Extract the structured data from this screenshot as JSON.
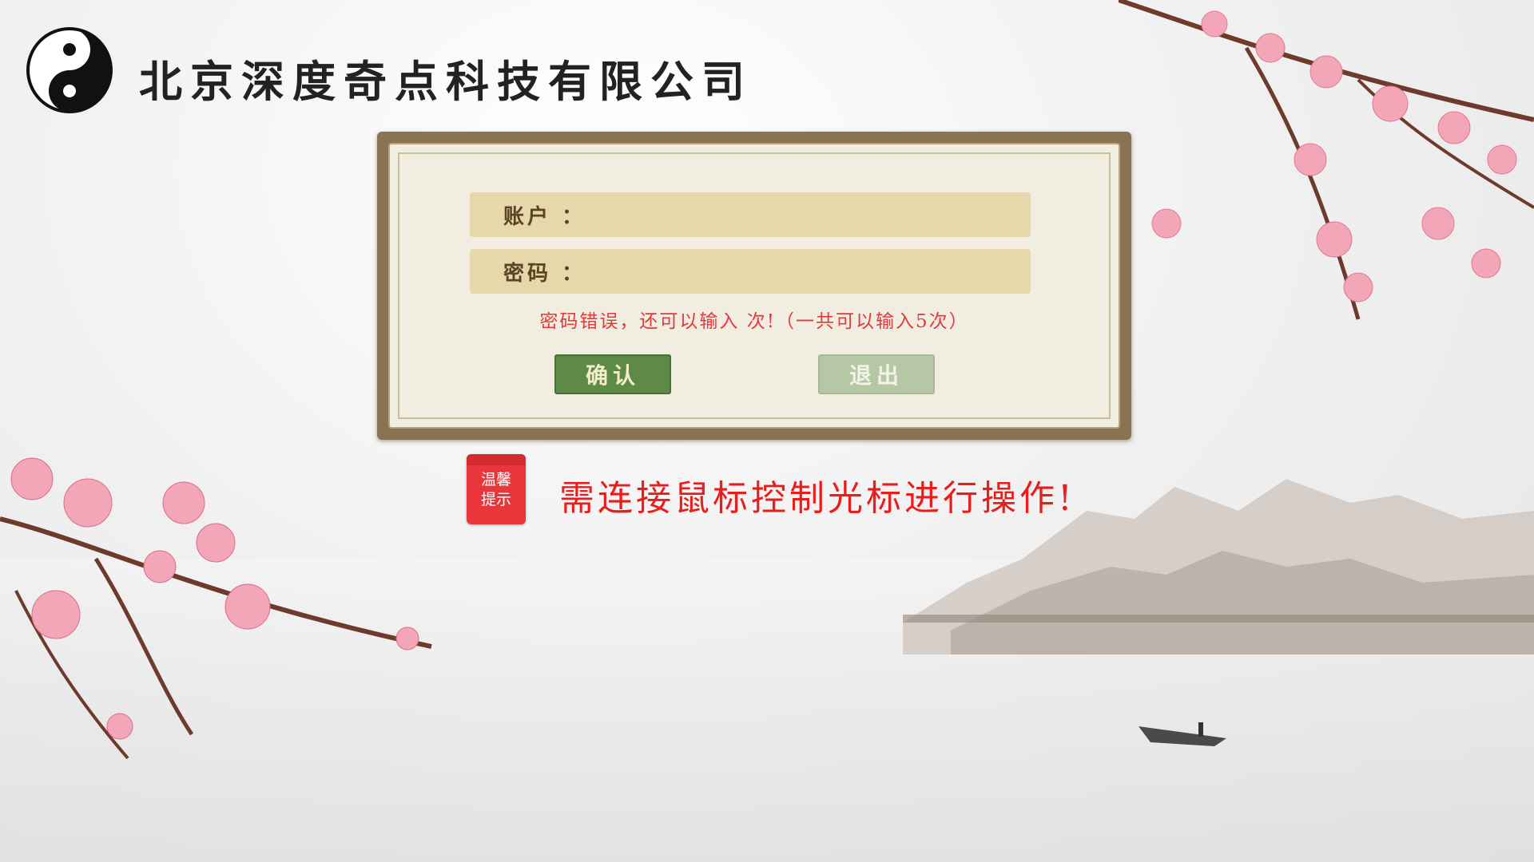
{
  "company": {
    "name": "北京深度奇点科技有限公司"
  },
  "login": {
    "account_label": "账户 ：",
    "account_value": "",
    "password_label": "密码 ：",
    "password_value": "",
    "error_message": "密码错误，还可以输入  次!（一共可以输入5次）",
    "confirm_label": "确认",
    "exit_label": "退出"
  },
  "tip": {
    "badge_line1": "温馨",
    "badge_line2": "提示",
    "message": "需连接鼠标控制光标进行操作!"
  },
  "colors": {
    "panel_frame": "#8a7350",
    "field_bg": "#e7d8ab",
    "confirm_bg": "#5e8a47",
    "exit_bg": "#b6c7a5",
    "error_text": "#e23a3a",
    "tip_text": "#ea1d1d"
  },
  "icons": {
    "logo": "yin-yang-logo-icon"
  }
}
